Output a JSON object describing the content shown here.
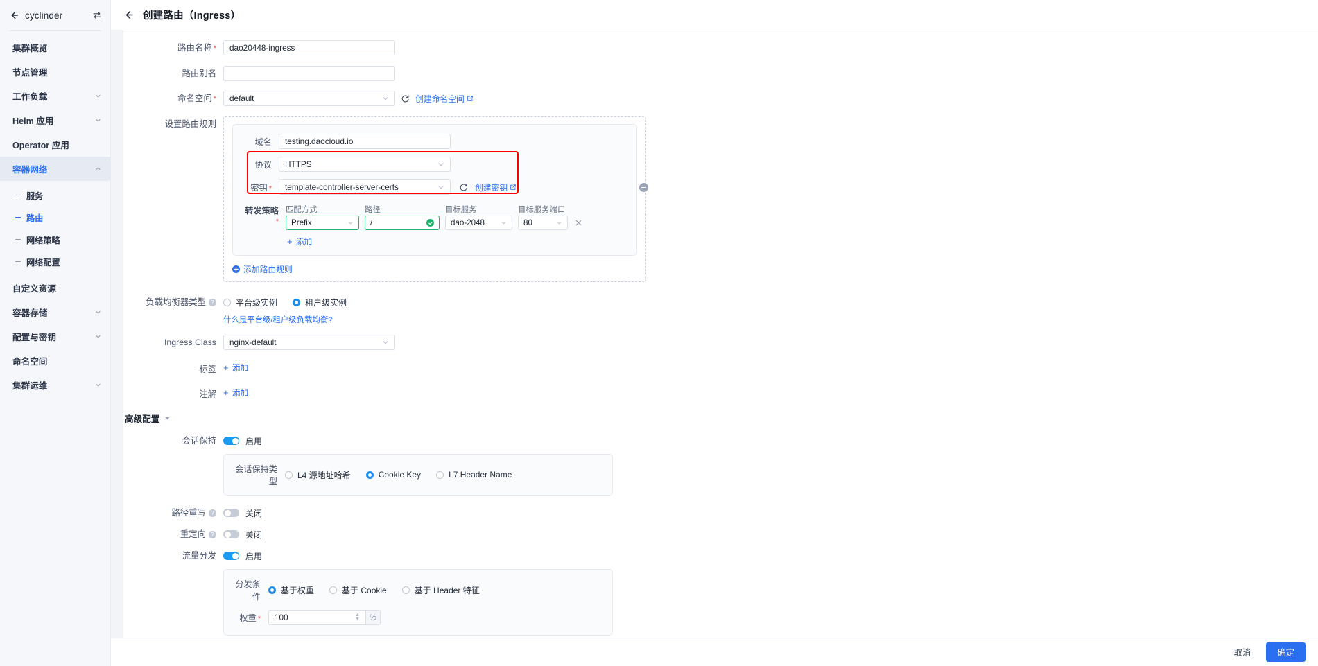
{
  "sidebar": {
    "cluster_name": "cyclinder",
    "back_icon": "arrow-left-icon",
    "switch_icon": "switch-cluster-icon",
    "items": [
      {
        "label": "集群概览",
        "type": "item"
      },
      {
        "label": "节点管理",
        "type": "item"
      },
      {
        "label": "工作负载",
        "type": "expandable"
      },
      {
        "label": "Helm 应用",
        "type": "expandable"
      },
      {
        "label": "Operator 应用",
        "type": "item"
      },
      {
        "label": "容器网络",
        "type": "expandable",
        "active": true,
        "expanded": true
      },
      {
        "label": "自定义资源",
        "type": "item"
      },
      {
        "label": "容器存储",
        "type": "expandable"
      },
      {
        "label": "配置与密钥",
        "type": "expandable"
      },
      {
        "label": "命名空间",
        "type": "item"
      },
      {
        "label": "集群运维",
        "type": "expandable"
      }
    ],
    "sub_items": [
      {
        "label": "服务",
        "current": false
      },
      {
        "label": "路由",
        "current": true
      },
      {
        "label": "网络策略",
        "current": false
      },
      {
        "label": "网络配置",
        "current": false
      }
    ]
  },
  "topbar": {
    "back_icon": "arrow-left-icon",
    "title": "创建路由（Ingress）"
  },
  "form": {
    "name_label": "路由名称",
    "name_value": "dao20448-ingress",
    "alias_label": "路由别名",
    "alias_value": "",
    "alias_placeholder": "",
    "namespace_label": "命名空间",
    "namespace_value": "default",
    "create_namespace_link": "创建命名空间",
    "rules_label": "设置路由规则",
    "rule": {
      "domain_label": "域名",
      "domain_value": "testing.daocloud.io",
      "protocol_label": "协议",
      "protocol_value": "HTTPS",
      "secret_label": "密钥",
      "secret_value": "template-controller-server-certs",
      "create_secret_link": "创建密钥",
      "forward_label": "转发策略",
      "col_match": "匹配方式",
      "col_path": "路径",
      "col_service": "目标服务",
      "col_port": "目标服务端口",
      "match_value": "Prefix",
      "path_value": "/",
      "service_value": "dao-2048",
      "port_value": "80",
      "add_forward_link": "添加",
      "remove_rule_icon": "minus-circle-icon",
      "remove_row_icon": "close-icon",
      "valid_icon": "check-circle-icon"
    },
    "add_rule_link": "添加路由规则",
    "lb_type_label": "负载均衡器类型",
    "lb_options": [
      {
        "label": "平台级实例",
        "selected": false
      },
      {
        "label": "租户级实例",
        "selected": true
      }
    ],
    "lb_help_link": "什么是平台级/租户级负载均衡?",
    "ingress_class_label": "Ingress Class",
    "ingress_class_value": "nginx-default",
    "labels_label": "标签",
    "labels_add": "添加",
    "annotations_label": "注解",
    "annotations_add": "添加"
  },
  "advanced": {
    "title": "高级配置",
    "session": {
      "label": "会话保持",
      "state": "启用",
      "enabled": true,
      "type_label": "会话保持类型",
      "options": [
        {
          "label": "L4 源地址哈希",
          "selected": false
        },
        {
          "label": "Cookie Key",
          "selected": true
        },
        {
          "label": "L7 Header Name",
          "selected": false
        }
      ]
    },
    "rewrite": {
      "label": "路径重写",
      "state": "关闭",
      "enabled": false
    },
    "redirect": {
      "label": "重定向",
      "state": "关闭",
      "enabled": false
    },
    "traffic": {
      "label": "流量分发",
      "state": "启用",
      "enabled": true,
      "condition_label": "分发条件",
      "options": [
        {
          "label": "基于权重",
          "selected": true
        },
        {
          "label": "基于 Cookie",
          "selected": false
        },
        {
          "label": "基于 Header 特征",
          "selected": false
        }
      ],
      "weight_label": "权重",
      "weight_value": "100",
      "weight_unit": "%"
    }
  },
  "footer": {
    "cancel": "取消",
    "confirm": "确定"
  },
  "colors": {
    "accent": "#2a6ff0",
    "highlight": "#ff0000",
    "valid": "#23b26d",
    "toggle_on": "#1a9bf0",
    "required": "#e34d59"
  }
}
